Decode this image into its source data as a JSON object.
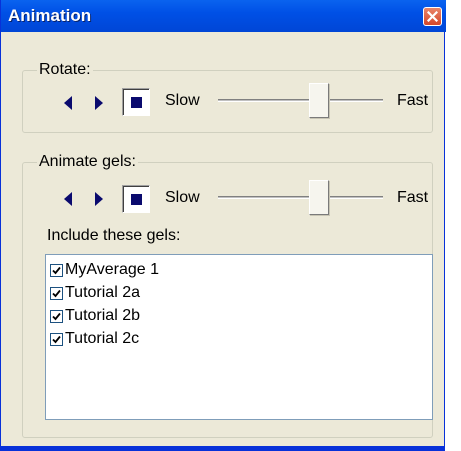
{
  "window": {
    "title": "Animation"
  },
  "rotate": {
    "legend": "Rotate:",
    "slow_label": "Slow",
    "fast_label": "Fast",
    "speed_percent": 68
  },
  "animate_gels": {
    "legend": "Animate gels:",
    "slow_label": "Slow",
    "fast_label": "Fast",
    "speed_percent": 68,
    "include_label": "Include these gels:",
    "gels": [
      {
        "label": "MyAverage 1",
        "checked": true
      },
      {
        "label": "Tutorial 2a",
        "checked": true
      },
      {
        "label": "Tutorial 2b",
        "checked": true
      },
      {
        "label": "Tutorial 2c",
        "checked": true
      }
    ]
  },
  "colors": {
    "titlebar": "#0050e6",
    "window_bg": "#ece9d8",
    "stop_square": "#0a0a6e",
    "close_button": "#d4462a"
  }
}
